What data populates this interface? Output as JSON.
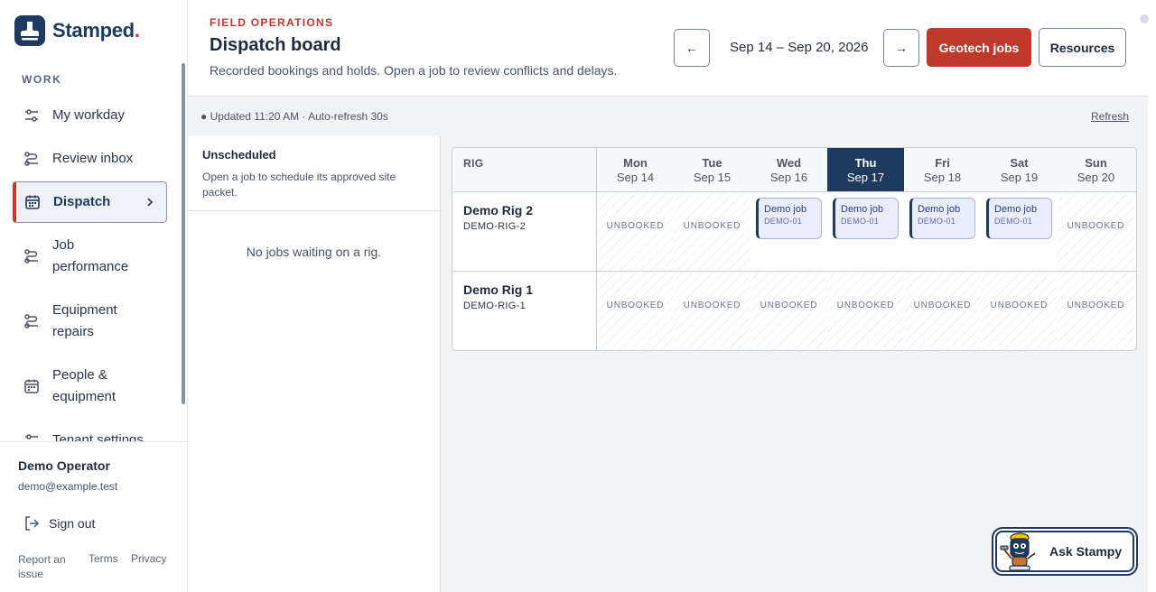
{
  "brand": {
    "name": "Stamped",
    "dot": "."
  },
  "sidebar": {
    "section": "WORK",
    "items": [
      {
        "label": "My workday",
        "icon": "sliders-icon"
      },
      {
        "label": "Review inbox",
        "icon": "route-icon"
      },
      {
        "label": "Dispatch",
        "icon": "calendar-icon",
        "active": true
      },
      {
        "label": "Job performance",
        "icon": "route-icon"
      },
      {
        "label": "Equipment repairs",
        "icon": "route-icon"
      },
      {
        "label": "People & equipment",
        "icon": "calendar-icon"
      },
      {
        "label": "Tenant settings",
        "icon": "sliders-icon"
      }
    ]
  },
  "user": {
    "name": "Demo Operator",
    "email": "demo@example.test",
    "signout": "Sign out",
    "links": {
      "report": "Report an issue",
      "terms": "Terms",
      "privacy": "Privacy"
    }
  },
  "header": {
    "eyebrow": "FIELD OPERATIONS",
    "title": "Dispatch board",
    "subtitle": "Recorded bookings and holds. Open a job to review conflicts and delays.",
    "prev": "←",
    "next": "→",
    "range": "Sep 14 – Sep 20, 2026",
    "primary": "Geotech jobs",
    "secondary": "Resources"
  },
  "status": {
    "text": "● Updated 11:20 AM · Auto-refresh 30s",
    "refresh": "Refresh"
  },
  "unscheduled": {
    "title": "Unscheduled",
    "desc": "Open a job to schedule its approved site packet.",
    "empty": "No jobs waiting on a rig."
  },
  "board": {
    "rig_header": "RIG",
    "days": [
      {
        "name": "Mon",
        "date": "Sep 14"
      },
      {
        "name": "Tue",
        "date": "Sep 15"
      },
      {
        "name": "Wed",
        "date": "Sep 16"
      },
      {
        "name": "Thu",
        "date": "Sep 17",
        "today": true
      },
      {
        "name": "Fri",
        "date": "Sep 18"
      },
      {
        "name": "Sat",
        "date": "Sep 19"
      },
      {
        "name": "Sun",
        "date": "Sep 20"
      }
    ],
    "unbooked_label": "UNBOOKED",
    "job": {
      "title": "Demo job",
      "code": "DEMO-01"
    },
    "rigs": [
      {
        "name": "Demo Rig 2",
        "code": "DEMO-RIG-2"
      },
      {
        "name": "Demo Rig 1",
        "code": "DEMO-RIG-1"
      }
    ]
  },
  "assistant": {
    "label": "Ask Stampy"
  }
}
